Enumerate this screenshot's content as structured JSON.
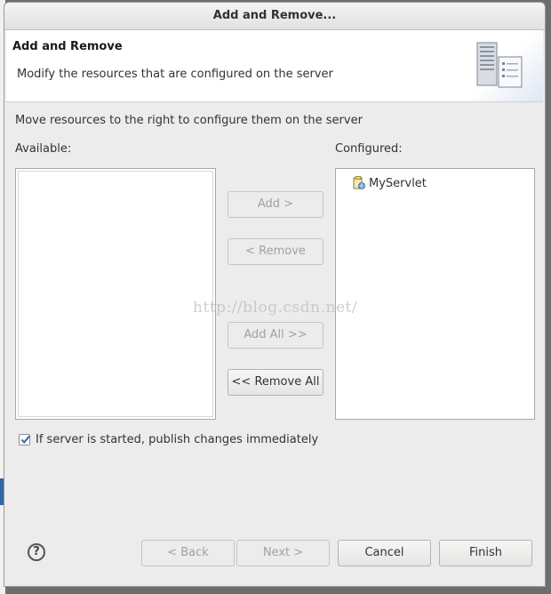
{
  "dialog": {
    "title": "Add and Remove...",
    "header_title": "Add and Remove",
    "header_description": "Modify the resources that are configured on the server",
    "instructions": "Move resources to the right to configure them on the server"
  },
  "available": {
    "label": "Available:",
    "items": []
  },
  "configured": {
    "label": "Configured:",
    "items": [
      {
        "label": "MyServlet",
        "icon": "web-project-icon"
      }
    ]
  },
  "transfer_buttons": {
    "add": "Add >",
    "remove": "< Remove",
    "add_all": "Add All >>",
    "remove_all": "<< Remove All"
  },
  "publish_checkbox": {
    "label": "If server is started, publish changes immediately",
    "checked": true
  },
  "footer": {
    "help_icon": "help-icon",
    "back": "< Back",
    "next": "Next >",
    "cancel": "Cancel",
    "finish": "Finish"
  },
  "watermark": "http://blog.csdn.net/"
}
